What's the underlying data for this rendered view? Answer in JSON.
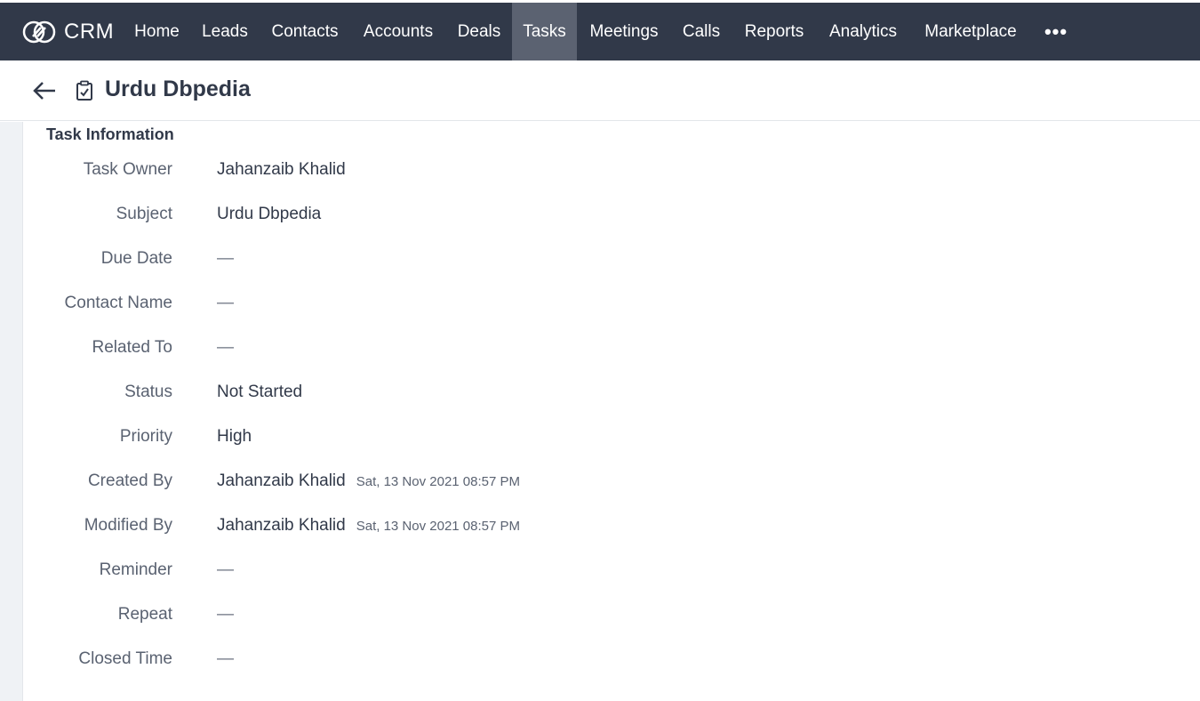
{
  "nav": {
    "logo_text": "CRM",
    "items": [
      "Home",
      "Leads",
      "Contacts",
      "Accounts",
      "Deals",
      "Tasks",
      "Meetings",
      "Calls",
      "Reports",
      "Analytics",
      "Marketplace"
    ],
    "active": "Tasks",
    "more_label": "•••"
  },
  "header": {
    "title": "Urdu Dbpedia",
    "back_icon": "arrow-left-icon",
    "record_icon": "task-check-icon"
  },
  "section": {
    "title": "Task Information",
    "fields": [
      {
        "label": "Task Owner",
        "value": "Jahanzaib Khalid",
        "timestamp": ""
      },
      {
        "label": "Subject",
        "value": "Urdu Dbpedia",
        "timestamp": ""
      },
      {
        "label": "Due Date",
        "value": "—",
        "timestamp": ""
      },
      {
        "label": "Contact Name",
        "value": "—",
        "timestamp": ""
      },
      {
        "label": "Related To",
        "value": "—",
        "timestamp": ""
      },
      {
        "label": "Status",
        "value": "Not Started",
        "timestamp": ""
      },
      {
        "label": "Priority",
        "value": "High",
        "timestamp": ""
      },
      {
        "label": "Created By",
        "value": "Jahanzaib Khalid",
        "timestamp": "Sat, 13 Nov 2021 08:57 PM"
      },
      {
        "label": "Modified By",
        "value": "Jahanzaib Khalid",
        "timestamp": "Sat, 13 Nov 2021 08:57 PM"
      },
      {
        "label": "Reminder",
        "value": "—",
        "timestamp": ""
      },
      {
        "label": "Repeat",
        "value": "—",
        "timestamp": ""
      },
      {
        "label": "Closed Time",
        "value": "—",
        "timestamp": ""
      }
    ]
  },
  "colors": {
    "navbar": "#313949",
    "nav_active": "#5b6271",
    "rail": "#eff2f5"
  }
}
